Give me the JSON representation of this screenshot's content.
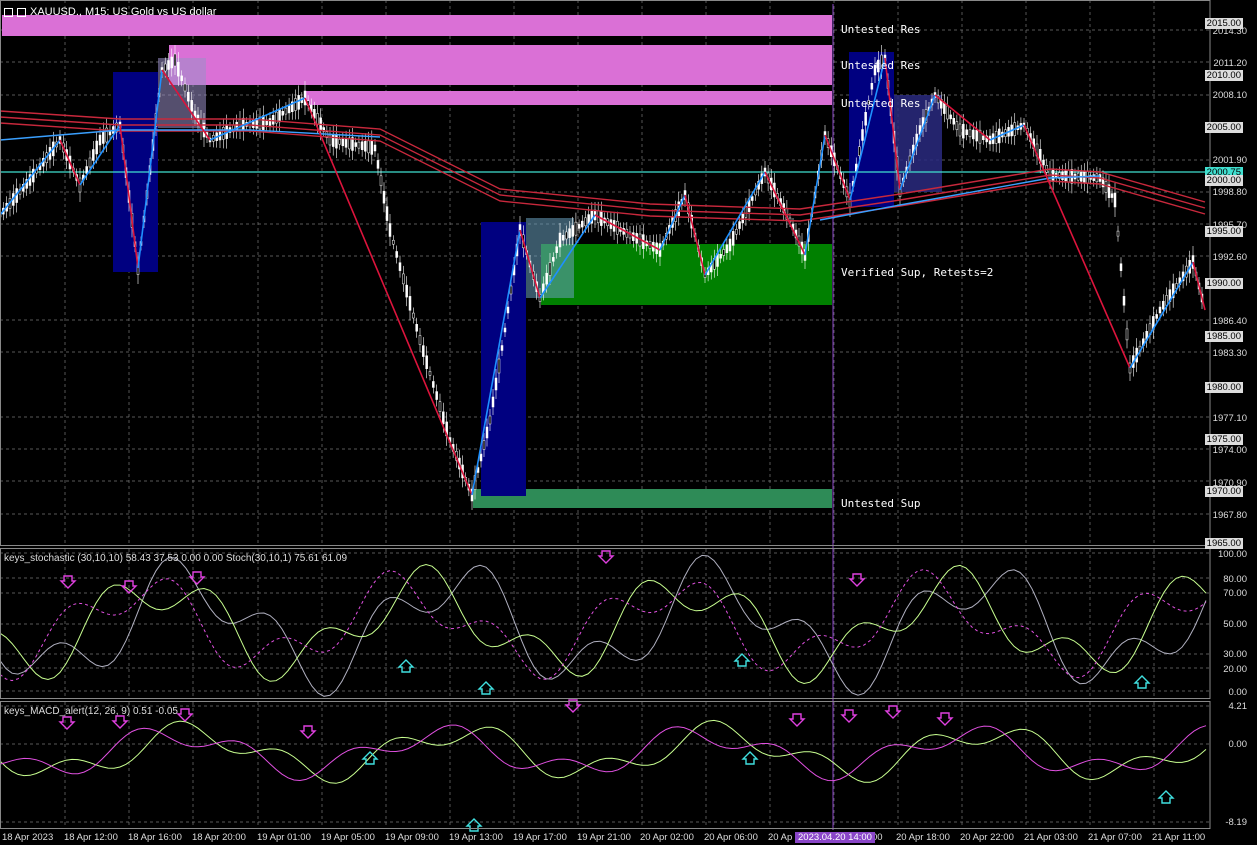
{
  "window": {
    "symbol_title": "XAUUSD., M15:  US Gold vs US dollar"
  },
  "indicators": {
    "stochastic_label": "keys_stochastic (30,10,10) 58.43 37.53 0.00 0.00 Stoch(30,10,1) 75.61 61.09",
    "macd_label": "keys_MACD_alert(12, 26, 9) 0.51 -0.05"
  },
  "zones": [
    {
      "label": "Untested Res"
    },
    {
      "label": "Untested Res"
    },
    {
      "label": "Untested Res"
    },
    {
      "label": "Verified Sup, Retests=2"
    },
    {
      "label": "Untested Sup"
    }
  ],
  "price_axis": {
    "labels": [
      "2014.30",
      "2011.20",
      "2008.10",
      "2001.90",
      "1998.80",
      "1995.70",
      "1992.60",
      "1986.40",
      "1983.30",
      "1977.10",
      "1974.00",
      "1970.90",
      "1967.80"
    ],
    "tags": [
      "2015.00",
      "2010.00",
      "2005.00",
      "2000.75",
      "2000.00",
      "1995.00",
      "1990.00",
      "1985.00",
      "1980.00",
      "1975.00",
      "1970.00",
      "1965.00"
    ],
    "current_price": "2000.75"
  },
  "stoch_axis": [
    "100.00",
    "80.00",
    "70.00",
    "50.00",
    "30.00",
    "20.00",
    "0.00"
  ],
  "macd_axis": [
    "4.21",
    "0.00",
    "-8.19"
  ],
  "time_axis": {
    "labels": [
      "18 Apr 2023",
      "18 Apr 12:00",
      "18 Apr 16:00",
      "18 Apr 20:00",
      "19 Apr 01:00",
      "19 Apr 05:00",
      "19 Apr 09:00",
      "19 Apr 13:00",
      "19 Apr 17:00",
      "19 Apr 21:00",
      "20 Apr 02:00",
      "20 Apr 06:00",
      "20 Ap",
      "00",
      "20 Apr 18:00",
      "20 Apr 22:00",
      "21 Apr 03:00",
      "21 Apr 07:00",
      "21 Apr 11:00"
    ],
    "cursor_time": "2023.04.20 14:00"
  },
  "colors": {
    "resistance": "#da70d6",
    "support_verified": "#008000",
    "support_untested": "#2e8b57",
    "impulse_box": "#000080",
    "zigzag_up": "#1e90ff",
    "zigzag_down": "#dc143c",
    "ma": "#c8283c",
    "current_line": "#40e0d0",
    "cursor_line": "#8a46c8"
  }
}
